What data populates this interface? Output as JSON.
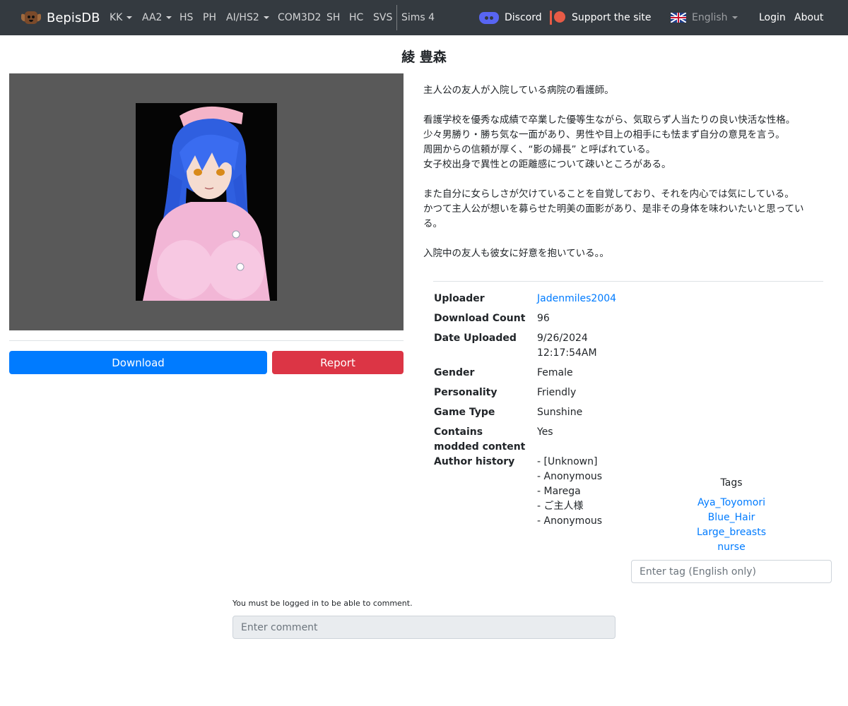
{
  "navbar": {
    "brand": "BepisDB",
    "items": [
      {
        "label": "KK",
        "dropdown": true
      },
      {
        "label": "AA2",
        "dropdown": true
      },
      {
        "label": "HS",
        "dropdown": false
      },
      {
        "label": "PH",
        "dropdown": false
      },
      {
        "label": "AI/HS2",
        "dropdown": true
      },
      {
        "label": "COM3D2",
        "dropdown": false
      },
      {
        "label": "SH",
        "dropdown": false
      },
      {
        "label": "HC",
        "dropdown": false
      },
      {
        "label": "SVS",
        "dropdown": false
      },
      {
        "label": "Sims 4",
        "dropdown": false
      }
    ],
    "discord": "Discord",
    "support": "Support the site",
    "language": "English",
    "login": "Login",
    "about": "About"
  },
  "card": {
    "title": "綾 豊森",
    "description": [
      "主人公の友人が入院している病院の看護師。",
      "",
      "看護学校を優秀な成績で卒業した優等生ながら、気取らず人当たりの良い快活な性格。",
      "少々男勝り・勝ち気な一面があり、男性や目上の相手にも怯まず自分の意見を言う。",
      "周囲からの信頼が厚く、“影の婦長” と呼ばれている。",
      "女子校出身で異性との距離感について疎いところがある。",
      "",
      "また自分に女らしさが欠けていることを自覚しており、それを内心では気にしている。",
      "かつて主人公が想いを募らせた明美の面影があり、是非その身体を味わいたいと思ってい",
      "る。",
      "",
      "入院中の友人も彼女に好意を抱いている。。"
    ]
  },
  "actions": {
    "download": "Download",
    "report": "Report"
  },
  "info": {
    "uploader_label": "Uploader",
    "uploader": "Jadenmiles2004",
    "download_count_label": "Download Count",
    "download_count": "96",
    "date_uploaded_label": "Date Uploaded",
    "date_uploaded_date": "9/26/2024",
    "date_uploaded_time": "12:17:54AM",
    "gender_label": "Gender",
    "gender": "Female",
    "personality_label": "Personality",
    "personality": "Friendly",
    "game_type_label": "Game Type",
    "game_type": "Sunshine",
    "modded_label_line1": "Contains",
    "modded_label_line2": "modded content",
    "modded": "Yes",
    "author_history_label": "Author history",
    "author_history": [
      "- [Unknown]",
      "- Anonymous",
      "- Marega",
      "- ご主人様",
      "- Anonymous"
    ]
  },
  "tags": {
    "heading": "Tags",
    "items": [
      "Aya_Toyomori",
      "Blue_Hair",
      "Large_breasts",
      "nurse"
    ],
    "input_placeholder": "Enter tag (English only)"
  },
  "comments": {
    "note": "You must be logged in to be able to comment.",
    "input_placeholder": "Enter comment"
  },
  "colors": {
    "navbar_bg": "#343a40",
    "download_button": "#007bff",
    "report_button": "#dc3545",
    "link": "#007bff",
    "image_frame_bg": "#595959"
  }
}
